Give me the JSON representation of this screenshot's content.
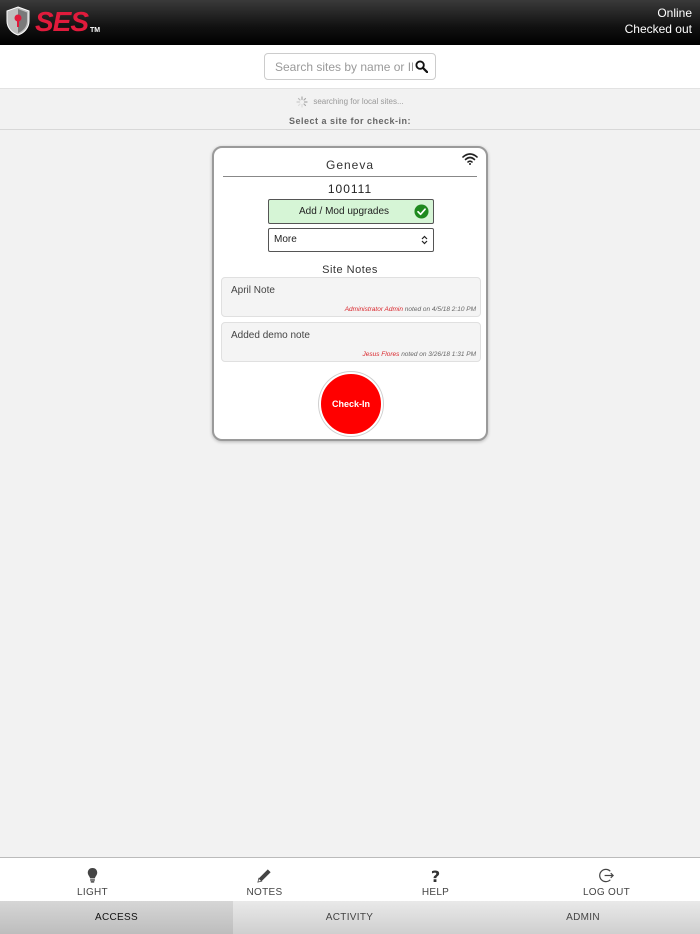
{
  "header": {
    "logo_text": "SES",
    "logo_tm": "TM",
    "status_line1": "Online",
    "status_line2": "Checked out"
  },
  "search": {
    "placeholder": "Search sites by name or ID",
    "value": ""
  },
  "info": {
    "searching_text": "searching for local sites...",
    "select_label": "Select a site for check-in:"
  },
  "site_card": {
    "name": "Geneva",
    "id": "100111",
    "upgrade_button": "Add / Mod upgrades",
    "more_select": "More",
    "notes_title": "Site Notes",
    "notes": [
      {
        "text": "April Note",
        "author": "Administrator Admin",
        "meta": "noted on 4/5/18 2:10 PM"
      },
      {
        "text": "Added demo note",
        "author": "Jesus Flores",
        "meta": "noted on 3/26/18 1:31 PM"
      }
    ],
    "checkin_label": "Check-In"
  },
  "toolbar": {
    "items": [
      {
        "label": "LIGHT",
        "icon": "bulb-icon"
      },
      {
        "label": "NOTES",
        "icon": "pencil-icon"
      },
      {
        "label": "HELP",
        "icon": "question-icon"
      },
      {
        "label": "LOG OUT",
        "icon": "logout-icon"
      }
    ]
  },
  "tabs": [
    {
      "label": "ACCESS",
      "active": true
    },
    {
      "label": "ACTIVITY",
      "active": false
    },
    {
      "label": "ADMIN",
      "active": false
    }
  ],
  "colors": {
    "brand_red": "#e01b3c",
    "checkin_red": "#ff0000",
    "upgrade_green": "#d6f5d6",
    "check_green": "#1f8a1f"
  }
}
